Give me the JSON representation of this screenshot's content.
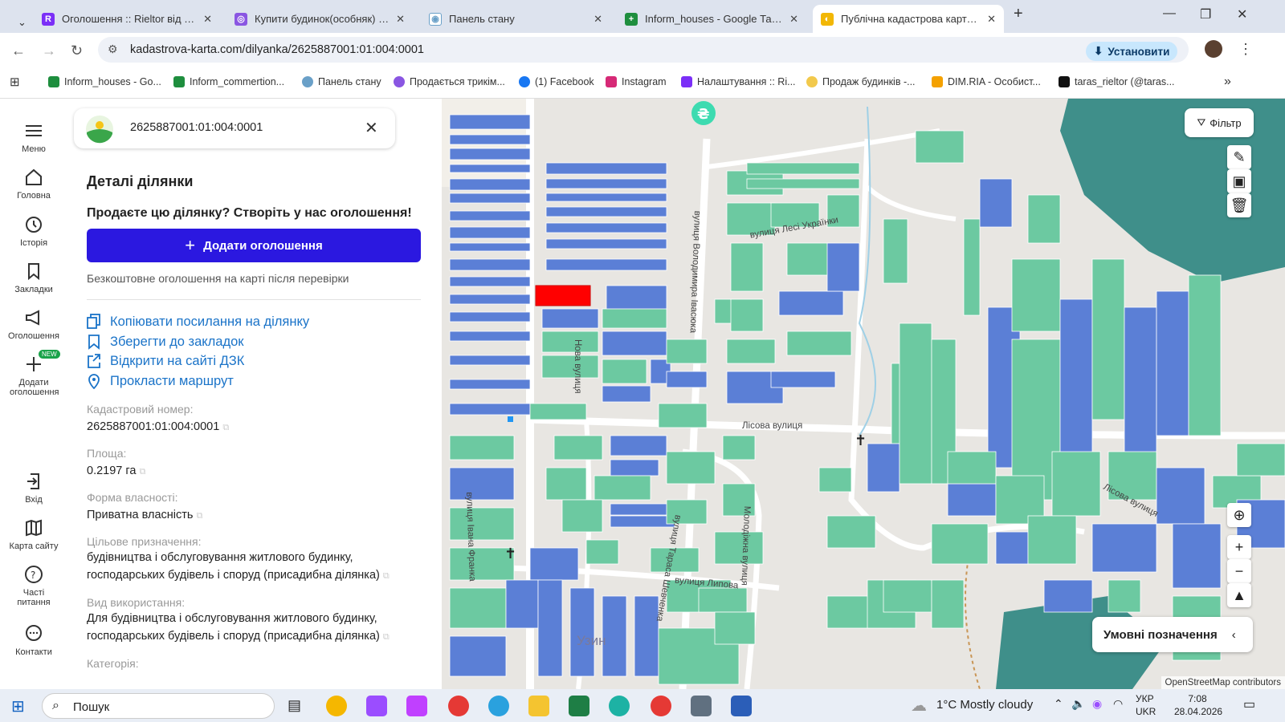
{
  "tabs": [
    {
      "title": "Оголошення :: Rieltor від ЛУН",
      "color": "#7b2ff7"
    },
    {
      "title": "Купити будинок(особняк) в Ів...",
      "color": "#8a56e2"
    },
    {
      "title": "Панель стану",
      "color": "#6aa0c8"
    },
    {
      "title": "Inform_houses - Google Таблиці",
      "color": "#1e8e3e"
    },
    {
      "title": "Публічна кадастрова карта Ук...",
      "color": "#f2b705"
    }
  ],
  "address": {
    "url": "kadastrova-karta.com/dilyanka/2625887001:01:004:0001",
    "install_label": "Установити"
  },
  "bookmarks": [
    {
      "label": "Inform_houses - Go...",
      "color": "#1e8e3e"
    },
    {
      "label": "Inform_commertion...",
      "color": "#1e8e3e"
    },
    {
      "label": "Панель стану",
      "color": "#6aa0c8"
    },
    {
      "label": "Продається трикім...",
      "color": "#8a56e2"
    },
    {
      "label": "(1) Facebook",
      "color": "#1877f2"
    },
    {
      "label": "Instagram",
      "color": "#d62976"
    },
    {
      "label": "Налаштування :: Ri...",
      "color": "#7b2ff7"
    },
    {
      "label": "Продаж будинків -...",
      "color": "#f2c94c"
    },
    {
      "label": "DIM.RIA - Особист...",
      "color": "#f4a100"
    },
    {
      "label": "taras_rieltor (@taras...",
      "color": "#111111"
    }
  ],
  "sidenav": [
    {
      "label": "Меню",
      "icon": "menu-icon"
    },
    {
      "label": "Головна",
      "icon": "home-icon"
    },
    {
      "label": "Історія",
      "icon": "history-icon"
    },
    {
      "label": "Закладки",
      "icon": "bookmark-icon"
    },
    {
      "label": "Оголошення",
      "icon": "megaphone-icon"
    },
    {
      "label": "Додати оголошення",
      "icon": "plus-icon",
      "badge": "NEW"
    },
    {
      "label": "Вхід",
      "icon": "login-icon"
    },
    {
      "label": "Карта сайту",
      "icon": "map-icon"
    },
    {
      "label": "Часті питання",
      "icon": "help-icon"
    },
    {
      "label": "Контакти",
      "icon": "chat-icon"
    }
  ],
  "panel": {
    "search_value": "2625887001:01:004:0001",
    "heading": "Деталі ділянки",
    "promo": "Продаєте цю ділянку? Створіть у нас оголошення!",
    "add_button": "Додати оголошення",
    "note": "Безкоштовне оголошення на карті після перевірки",
    "actions": [
      {
        "label": "Копіювати посилання на ділянку",
        "icon": "copy-icon"
      },
      {
        "label": "Зберегти до закладок",
        "icon": "bookmark-icon"
      },
      {
        "label": "Відкрити на сайті ДЗК",
        "icon": "external-link-icon"
      },
      {
        "label": "Прокласти маршрут",
        "icon": "location-pin-icon"
      }
    ],
    "fields": [
      {
        "label": "Кадастровий номер:",
        "value": "2625887001:01:004:0001"
      },
      {
        "label": "Площа:",
        "value": "0.2197 га"
      },
      {
        "label": "Форма власності:",
        "value": "Приватна власність"
      },
      {
        "label": "Цільове призначення:",
        "value": "будівництва і обслуговування житлового будинку, господарських будівель і споруд (присадибна ділянка)"
      },
      {
        "label": "Вид використання:",
        "value": "Для будівництва і обслуговування житлового будинку, господарських будівель і споруд (присадибна ділянка)"
      },
      {
        "label": "Категорія:",
        "value": ""
      }
    ]
  },
  "map": {
    "filter_label": "Фільтр",
    "legend_label": "Умовні позначення",
    "attribution": "OpenStreetMap contributors",
    "streets": [
      "вулиця Лесі Українки",
      "Лісова вулиця",
      "вулиця Івана Франка",
      "Нова вулиця",
      "вулиця Тараса Шевченка",
      "вулиця Липова",
      "Молодіжна вулиця",
      "вулиця Володимира Івасюка",
      "Лісова вулиця",
      "Узин"
    ],
    "colors": {
      "parcel_blue": "#5b7fd6",
      "parcel_green": "#6cc9a1",
      "selected": "#ff0000",
      "forest": "#3f8f8a"
    }
  },
  "taskbar": {
    "search_label": "Пошук",
    "weather": "1°C  Mostly cloudy",
    "lang_top": "УКР",
    "lang_bottom": "UKR",
    "time": "7:08",
    "date": "28.04.2026"
  }
}
